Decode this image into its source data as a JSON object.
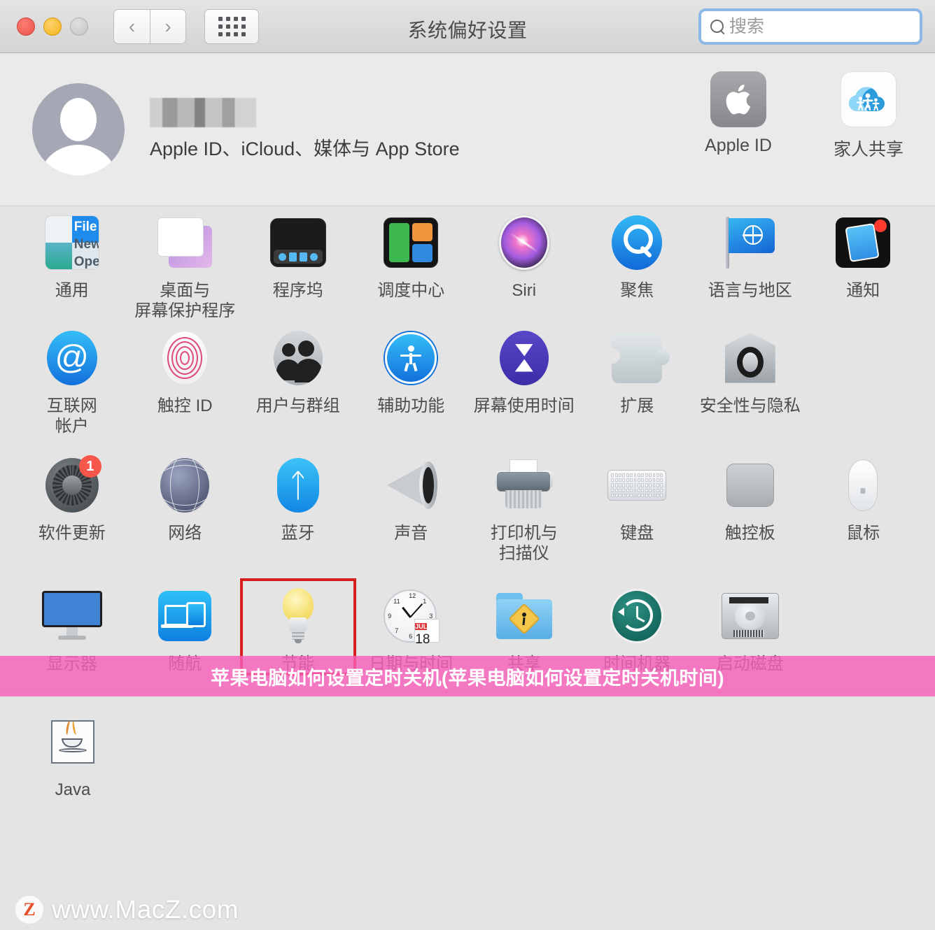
{
  "window": {
    "title": "系统偏好设置",
    "traffic_lights": [
      "close",
      "minimize",
      "zoom"
    ],
    "nav_back": "‹",
    "nav_forward": "›",
    "grid_button": "show-all-grid"
  },
  "search": {
    "placeholder": "搜索",
    "value": "",
    "icon": "search-icon",
    "focused": true,
    "focus_ring_color": "#8cb8e8"
  },
  "account": {
    "name_masked": "",
    "subtitle": "Apple ID、iCloud、媒体与 App Store",
    "avatar": "default-user-avatar",
    "shortcuts": [
      {
        "label": "Apple ID",
        "icon": "apple-logo-icon"
      },
      {
        "label": "家人共享",
        "icon": "family-sharing-cloud-icon"
      }
    ]
  },
  "banner": {
    "text": "苹果电脑如何设置定时关机(苹果电脑如何设置定时关机时间)",
    "background_color": "#f660b9",
    "text_color": "#ffffff"
  },
  "watermark": {
    "logo_letter": "Z",
    "text": "www.MacZ.com"
  },
  "annotation": {
    "highlighted_item": "节能",
    "outline_color": "#d81f1f"
  },
  "grid": {
    "rows": [
      [
        {
          "label": "通用",
          "icon": "general-icon"
        },
        {
          "label": "桌面与\n屏幕保护程序",
          "icon": "desktop-screensaver-icon"
        },
        {
          "label": "程序坞",
          "icon": "dock-icon"
        },
        {
          "label": "调度中心",
          "icon": "mission-control-icon"
        },
        {
          "label": "Siri",
          "icon": "siri-icon"
        },
        {
          "label": "聚焦",
          "icon": "spotlight-icon"
        },
        {
          "label": "语言与地区",
          "icon": "language-region-flag-icon"
        },
        {
          "label": "通知",
          "icon": "notifications-icon"
        }
      ],
      [
        {
          "label": "互联网\n帐户",
          "icon": "internet-accounts-at-icon"
        },
        {
          "label": "触控 ID",
          "icon": "touch-id-fingerprint-icon"
        },
        {
          "label": "用户与群组",
          "icon": "users-groups-icon"
        },
        {
          "label": "辅助功能",
          "icon": "accessibility-icon"
        },
        {
          "label": "屏幕使用时间",
          "icon": "screen-time-hourglass-icon"
        },
        {
          "label": "扩展",
          "icon": "extensions-puzzle-icon"
        },
        {
          "label": "安全性与隐私",
          "icon": "security-privacy-house-icon"
        },
        {
          "label": "",
          "icon": ""
        }
      ],
      [
        {
          "label": "软件更新",
          "icon": "software-update-gear-icon",
          "badge": "1"
        },
        {
          "label": "网络",
          "icon": "network-globe-icon"
        },
        {
          "label": "蓝牙",
          "icon": "bluetooth-icon"
        },
        {
          "label": "声音",
          "icon": "sound-speaker-icon"
        },
        {
          "label": "打印机与\n扫描仪",
          "icon": "printers-scanners-icon"
        },
        {
          "label": "键盘",
          "icon": "keyboard-icon"
        },
        {
          "label": "触控板",
          "icon": "trackpad-icon"
        },
        {
          "label": "鼠标",
          "icon": "mouse-icon"
        }
      ],
      [
        {
          "label": "显示器",
          "icon": "displays-icon"
        },
        {
          "label": "随航",
          "icon": "sidecar-icon"
        },
        {
          "label": "节能",
          "icon": "energy-saver-bulb-icon",
          "highlighted": true
        },
        {
          "label": "日期与时间",
          "icon": "date-time-clock-icon",
          "month": "JUL",
          "day": "18"
        },
        {
          "label": "共享",
          "icon": "sharing-folder-icon"
        },
        {
          "label": "时间机器",
          "icon": "time-machine-icon"
        },
        {
          "label": "启动磁盘",
          "icon": "startup-disk-icon"
        },
        {
          "label": "",
          "icon": ""
        }
      ]
    ],
    "third_party": [
      {
        "label": "Java",
        "icon": "java-icon"
      }
    ]
  }
}
